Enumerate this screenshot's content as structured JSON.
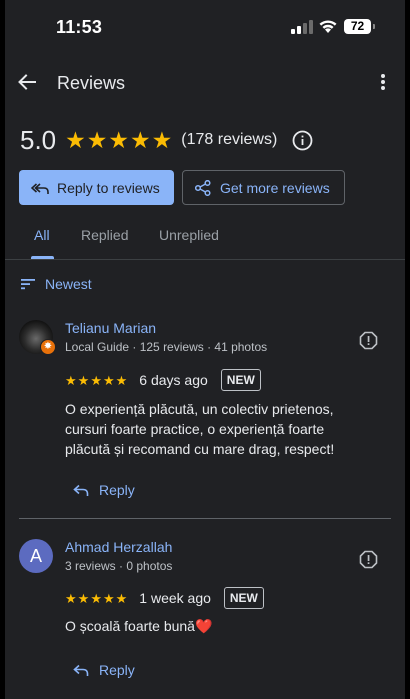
{
  "status_bar": {
    "time": "11:53",
    "battery": "72"
  },
  "app_bar": {
    "title": "Reviews"
  },
  "summary": {
    "rating": "5.0",
    "stars": 5,
    "review_count": "(178 reviews)"
  },
  "actions": {
    "reply_label": "Reply to reviews",
    "get_more_label": "Get more reviews"
  },
  "tabs": [
    {
      "label": "All",
      "active": true
    },
    {
      "label": "Replied",
      "active": false
    },
    {
      "label": "Unreplied",
      "active": false
    }
  ],
  "sort": {
    "label": "Newest"
  },
  "reviews": [
    {
      "name": "Telianu Marian",
      "meta": "Local Guide · 125 reviews · 41 photos",
      "stars": 5,
      "date": "6 days ago",
      "badge": "NEW",
      "text": "O experiență plăcută, un colectiv prietenos, cursuri foarte practice, o experiență foarte plăcută și recomand cu mare drag, respect!",
      "reply_label": "Reply"
    },
    {
      "name": "Ahmad Herzallah",
      "avatar_letter": "A",
      "meta": "3 reviews · 0 photos",
      "stars": 5,
      "date": "1 week ago",
      "badge": "NEW",
      "text": "O școală foarte bună❤️",
      "reply_label": "Reply"
    }
  ],
  "colors": {
    "accent": "#8ab4f8",
    "star": "#fbbc04",
    "background": "#202124",
    "avatar_a": "#5c6bc0",
    "local_guide_badge": "#e8710a"
  },
  "icons": [
    "back-arrow-icon",
    "more-vert-icon",
    "star-icon",
    "info-icon",
    "reply-all-icon",
    "share-icon",
    "sort-icon",
    "local-guide-icon",
    "report-icon",
    "reply-icon"
  ]
}
